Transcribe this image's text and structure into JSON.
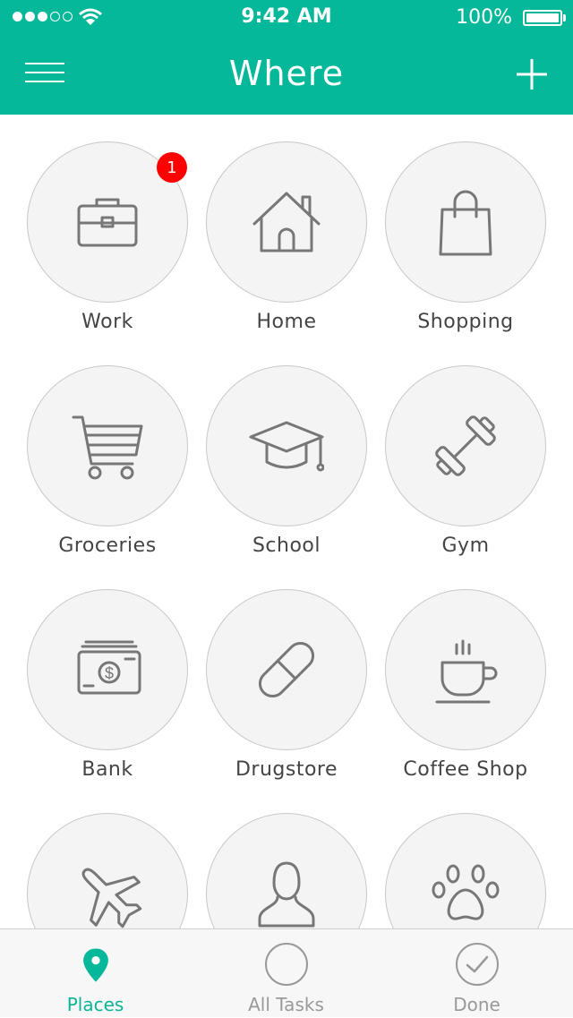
{
  "colors": {
    "accent": "#05b899",
    "badge": "#ff0000",
    "icon_stroke": "#777777"
  },
  "status_bar": {
    "signal_bars": 5,
    "signal_filled": 3,
    "time": "9:42 AM",
    "battery_percent": "100%"
  },
  "nav": {
    "title": "Where",
    "menu_icon": "hamburger-icon",
    "add_icon": "plus-icon"
  },
  "places": [
    {
      "label": "Work",
      "icon": "briefcase-icon",
      "badge": "1"
    },
    {
      "label": "Home",
      "icon": "house-icon"
    },
    {
      "label": "Shopping",
      "icon": "shopping-bag-icon"
    },
    {
      "label": "Groceries",
      "icon": "shopping-cart-icon"
    },
    {
      "label": "School",
      "icon": "graduation-cap-icon"
    },
    {
      "label": "Gym",
      "icon": "dumbbell-icon"
    },
    {
      "label": "Bank",
      "icon": "money-icon"
    },
    {
      "label": "Drugstore",
      "icon": "pill-icon"
    },
    {
      "label": "Coffee Shop",
      "icon": "coffee-cup-icon"
    },
    {
      "label": "",
      "icon": "airplane-icon"
    },
    {
      "label": "",
      "icon": "person-icon"
    },
    {
      "label": "",
      "icon": "paw-icon"
    }
  ],
  "tabs": [
    {
      "label": "Places",
      "icon": "map-pin-icon",
      "active": true
    },
    {
      "label": "All Tasks",
      "icon": "circle-icon",
      "active": false
    },
    {
      "label": "Done",
      "icon": "check-circle-icon",
      "active": false
    }
  ]
}
